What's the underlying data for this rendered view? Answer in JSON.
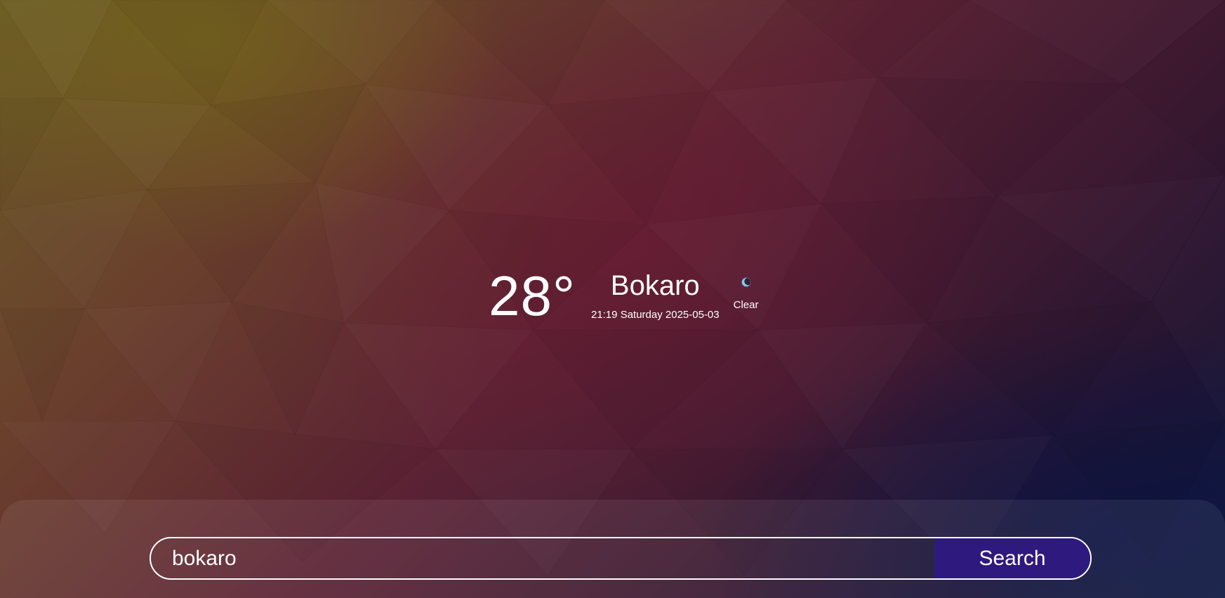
{
  "weather": {
    "temperature": "28°",
    "city": "Bokaro",
    "datetime": "21:19 Saturday 2025-05-03",
    "condition": "Clear",
    "condition_icon": "moon-icon"
  },
  "search": {
    "value": "bokaro",
    "button_label": "Search"
  },
  "colors": {
    "search_button": "#2e1a7e",
    "text": "#ffffff"
  }
}
